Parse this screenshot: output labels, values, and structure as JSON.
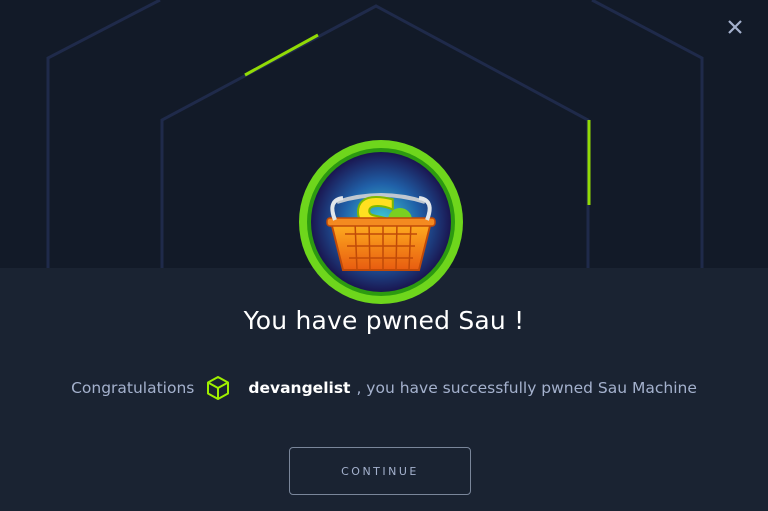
{
  "modal": {
    "title": "You have pwned Sau !",
    "congrats_word": "Congratulations",
    "username": "devangelist",
    "success_text": ", you have successfully pwned Sau Machine",
    "continue_label": "CONTINUE",
    "badge_letter": "S"
  },
  "icons": {
    "close": "close-icon",
    "user_cube": "cube-icon",
    "machine_badge": "machine-badge-icon"
  },
  "colors": {
    "background": "#141d2b",
    "accent_green": "#9fef00",
    "title_text": "#ffffff",
    "muted_text": "#a4b1cd"
  }
}
